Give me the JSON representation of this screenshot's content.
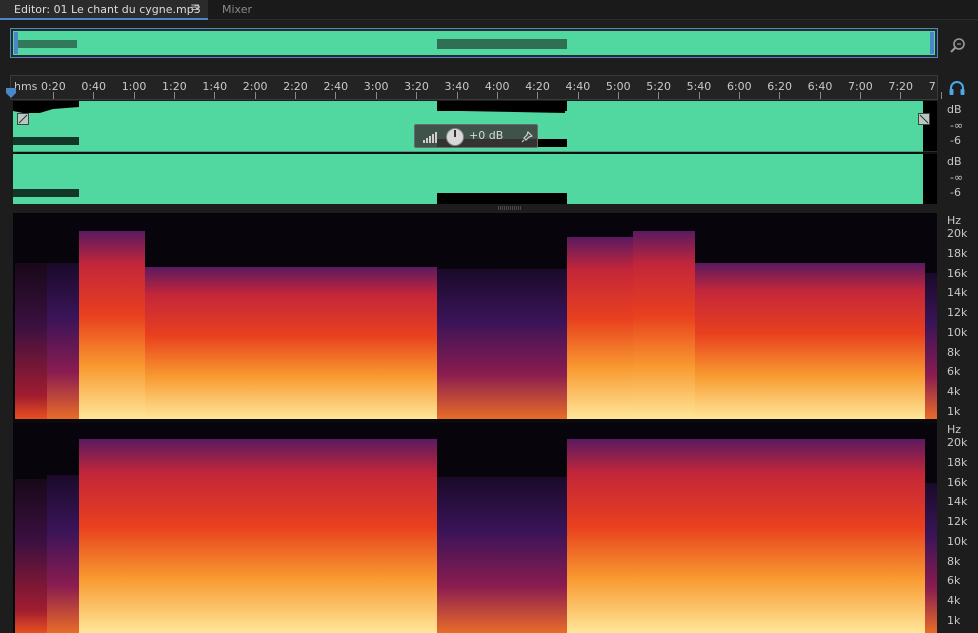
{
  "tabs": {
    "editor_label": "Editor: 01 Le chant du cygne.mp3",
    "mixer_label": "Mixer",
    "menu_glyph": "≡"
  },
  "ruler": {
    "unit": "hms",
    "labels": [
      "0:20",
      "0:40",
      "1:00",
      "1:20",
      "1:40",
      "2:00",
      "2:20",
      "2:40",
      "3:00",
      "3:20",
      "3:40",
      "4:00",
      "4:20",
      "4:40",
      "5:00",
      "5:20",
      "5:40",
      "6:00",
      "6:20",
      "6:40",
      "7:00",
      "7:20",
      "7"
    ]
  },
  "amplitude_hud": {
    "value": "+0 dB"
  },
  "waveform_scale": {
    "unit": "dB",
    "labels": [
      "-∞",
      "-6"
    ]
  },
  "spectrogram_scale": {
    "unit": "Hz",
    "labels": [
      "20k",
      "18k",
      "16k",
      "14k",
      "12k",
      "10k",
      "8k",
      "6k",
      "4k",
      "1k"
    ]
  },
  "colors": {
    "accent": "#4a86c8",
    "waveform": "#50d8a0",
    "spectrum_hot": "#ffe080",
    "spectrum_mid": "#e04020",
    "spectrum_low": "#3a1450"
  },
  "icons": {
    "zoom": "zoom-magnifier-icon",
    "headphones": "headphones-icon",
    "playhead": "playhead-marker-icon",
    "pin": "pin-icon",
    "knob": "volume-knob-icon",
    "meter": "level-meter-icon"
  }
}
